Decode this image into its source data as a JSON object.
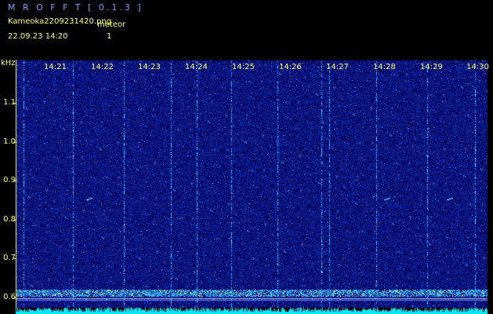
{
  "app": {
    "title": "M R O F F T  [ 0.1.3 ]"
  },
  "info": {
    "filename": "Kameoka2209231420.png",
    "datetime": "22.09.23  14:20",
    "meteor_label": "meteor",
    "meteor_count": "1"
  },
  "axis": {
    "unit": "kHz",
    "y_ticks": [
      "1.1",
      "1.0",
      "0.9",
      "0.8",
      "0.7",
      "0.6"
    ],
    "x_ticks": [
      "14:21",
      "14:22",
      "14:23",
      "14:24",
      "14:25",
      "14:26",
      "14:27",
      "14:28",
      "14:29",
      "14:30"
    ]
  },
  "colors": {
    "background": "#000000",
    "text": "#ffff66",
    "title": "#8b93ff",
    "spectrum_noise": "#1428a0",
    "signal": "#00ffff"
  }
}
